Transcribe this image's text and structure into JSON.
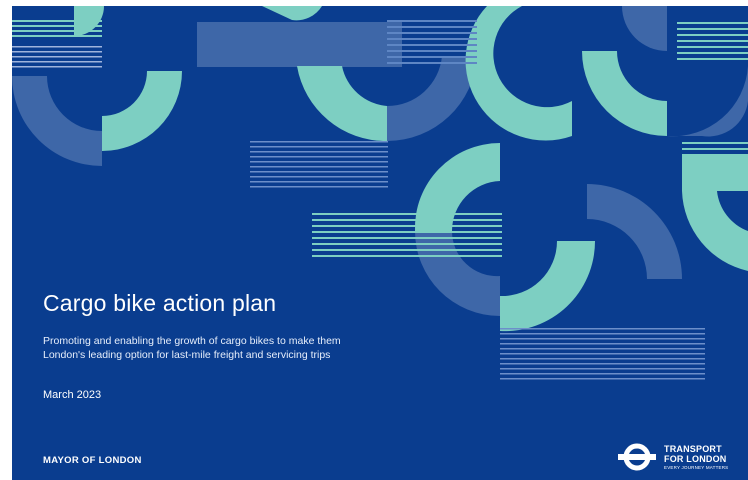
{
  "cover": {
    "title": "Cargo bike action plan",
    "subtitle": "Promoting and enabling the growth of cargo bikes to make them London's leading option for last-mile freight and servicing trips",
    "date": "March 2023"
  },
  "footer": {
    "mayor": "MAYOR OF LONDON",
    "tfl_line1": "TRANSPORT",
    "tfl_line2": "FOR LONDON",
    "tfl_tagline": "EVERY JOURNEY MATTERS"
  },
  "colors": {
    "background": "#0a3d8f",
    "teal": "#7dcfc2",
    "slate": "#3e67a8",
    "white": "#ffffff"
  },
  "icons": {
    "tfl_logo": "tfl-roundel-icon"
  }
}
